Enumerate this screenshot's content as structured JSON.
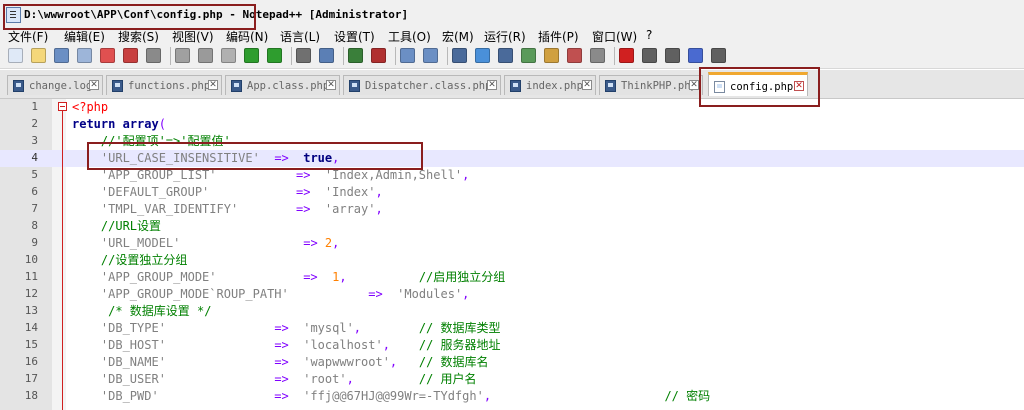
{
  "window": {
    "title": "D:\\wwwroot\\APP\\Conf\\config.php - Notepad++ [Administrator]"
  },
  "menu": {
    "items": [
      "文件(F)",
      "编辑(E)",
      "搜索(S)",
      "视图(V)",
      "编码(N)",
      "语言(L)",
      "设置(T)",
      "工具(O)",
      "宏(M)",
      "运行(R)",
      "插件(P)",
      "窗口(W)",
      "?"
    ]
  },
  "toolbar": {
    "icons": [
      "new-file-icon",
      "open-file-icon",
      "save-icon",
      "save-all-icon",
      "close-icon",
      "close-all-icon",
      "print-icon",
      "cut-icon",
      "copy-icon",
      "paste-icon",
      "undo-icon",
      "redo-icon",
      "find-icon",
      "replace-icon",
      "zoom-in-icon",
      "zoom-out-icon",
      "sync-vertical-icon",
      "sync-horizontal-icon",
      "word-wrap-icon",
      "show-all-chars-icon",
      "indent-guide-icon",
      "doc-map-icon",
      "function-list-icon",
      "folder-workspace-icon",
      "monitor-icon",
      "record-macro-icon",
      "stop-macro-icon",
      "play-macro-icon",
      "run-macro-multiple-icon",
      "save-macro-icon"
    ]
  },
  "tabs": [
    {
      "label": "change.log",
      "active": false
    },
    {
      "label": "functions.php",
      "active": false
    },
    {
      "label": "App.class.php",
      "active": false
    },
    {
      "label": "Dispatcher.class.php",
      "active": false
    },
    {
      "label": "index.php",
      "active": false
    },
    {
      "label": "ThinkPHP.php",
      "active": false
    },
    {
      "label": "config.php",
      "active": true
    }
  ],
  "editor": {
    "current_line": 4,
    "lines": [
      {
        "n": "1",
        "parts": [
          [
            "tag",
            "<?php"
          ]
        ]
      },
      {
        "n": "2",
        "parts": [
          [
            "kw",
            "return"
          ],
          [
            "pl",
            " "
          ],
          [
            "kw",
            "array"
          ],
          [
            "op",
            "("
          ]
        ]
      },
      {
        "n": "3",
        "parts": [
          [
            "cmt",
            "    //'配置项'=>'配置值'"
          ]
        ]
      },
      {
        "n": "4",
        "parts": [
          [
            "pl",
            "    "
          ],
          [
            "str",
            "'URL_CASE_INSENSITIVE'"
          ],
          [
            "pl",
            "  "
          ],
          [
            "op",
            "=>"
          ],
          [
            "pl",
            "  "
          ],
          [
            "bool",
            "true"
          ],
          [
            "op",
            ","
          ]
        ]
      },
      {
        "n": "5",
        "parts": [
          [
            "pl",
            "    "
          ],
          [
            "str",
            "'APP_GROUP_LIST'"
          ],
          [
            "pl",
            "           "
          ],
          [
            "op",
            "=>"
          ],
          [
            "pl",
            "  "
          ],
          [
            "str",
            "'Index,Admin,Shell'"
          ],
          [
            "op",
            ","
          ]
        ]
      },
      {
        "n": "6",
        "parts": [
          [
            "pl",
            "    "
          ],
          [
            "str",
            "'DEFAULT_GROUP'"
          ],
          [
            "pl",
            "            "
          ],
          [
            "op",
            "=>"
          ],
          [
            "pl",
            "  "
          ],
          [
            "str",
            "'Index'"
          ],
          [
            "op",
            ","
          ]
        ]
      },
      {
        "n": "7",
        "parts": [
          [
            "pl",
            "    "
          ],
          [
            "str",
            "'TMPL_VAR_IDENTIFY'"
          ],
          [
            "pl",
            "        "
          ],
          [
            "op",
            "=>"
          ],
          [
            "pl",
            "  "
          ],
          [
            "str",
            "'array'"
          ],
          [
            "op",
            ","
          ]
        ]
      },
      {
        "n": "8",
        "parts": [
          [
            "cmt",
            "    //URL设置"
          ]
        ]
      },
      {
        "n": "9",
        "parts": [
          [
            "pl",
            "    "
          ],
          [
            "str",
            "'URL_MODEL'"
          ],
          [
            "pl",
            "                 "
          ],
          [
            "op",
            "=>"
          ],
          [
            "pl",
            " "
          ],
          [
            "num",
            "2"
          ],
          [
            "op",
            ","
          ]
        ]
      },
      {
        "n": "10",
        "parts": [
          [
            "cmt",
            "    //设置独立分组"
          ]
        ]
      },
      {
        "n": "11",
        "parts": [
          [
            "pl",
            "    "
          ],
          [
            "str",
            "'APP_GROUP_MODE'"
          ],
          [
            "pl",
            "            "
          ],
          [
            "op",
            "=>"
          ],
          [
            "pl",
            "  "
          ],
          [
            "num",
            "1"
          ],
          [
            "op",
            ","
          ],
          [
            "pl",
            "          "
          ],
          [
            "cmt",
            "//启用独立分组"
          ]
        ]
      },
      {
        "n": "12",
        "parts": [
          [
            "pl",
            "    "
          ],
          [
            "str",
            "'APP_GROUP_MODE`ROUP_PATH'"
          ],
          [
            "pl",
            "           "
          ],
          [
            "op",
            "=>"
          ],
          [
            "pl",
            "  "
          ],
          [
            "str",
            "'Modules'"
          ],
          [
            "op",
            ","
          ]
        ]
      },
      {
        "n": "13",
        "parts": [
          [
            "cmt",
            "     /* 数据库设置 */"
          ]
        ]
      },
      {
        "n": "14",
        "parts": [
          [
            "pl",
            "    "
          ],
          [
            "str",
            "'DB_TYPE'"
          ],
          [
            "pl",
            "               "
          ],
          [
            "op",
            "=>"
          ],
          [
            "pl",
            "  "
          ],
          [
            "str",
            "'mysql'"
          ],
          [
            "op",
            ","
          ],
          [
            "pl",
            "        "
          ],
          [
            "cmt",
            "// 数据库类型"
          ]
        ]
      },
      {
        "n": "15",
        "parts": [
          [
            "pl",
            "    "
          ],
          [
            "str",
            "'DB_HOST'"
          ],
          [
            "pl",
            "               "
          ],
          [
            "op",
            "=>"
          ],
          [
            "pl",
            "  "
          ],
          [
            "str",
            "'localhost'"
          ],
          [
            "op",
            ","
          ],
          [
            "pl",
            "    "
          ],
          [
            "cmt",
            "// 服务器地址"
          ]
        ]
      },
      {
        "n": "16",
        "parts": [
          [
            "pl",
            "    "
          ],
          [
            "str",
            "'DB_NAME'"
          ],
          [
            "pl",
            "               "
          ],
          [
            "op",
            "=>"
          ],
          [
            "pl",
            "  "
          ],
          [
            "str",
            "'wapwwwroot'"
          ],
          [
            "op",
            ","
          ],
          [
            "pl",
            "   "
          ],
          [
            "cmt",
            "// 数据库名"
          ]
        ]
      },
      {
        "n": "17",
        "parts": [
          [
            "pl",
            "    "
          ],
          [
            "str",
            "'DB_USER'"
          ],
          [
            "pl",
            "               "
          ],
          [
            "op",
            "=>"
          ],
          [
            "pl",
            "  "
          ],
          [
            "str",
            "'root'"
          ],
          [
            "op",
            ","
          ],
          [
            "pl",
            "         "
          ],
          [
            "cmt",
            "// 用户名"
          ]
        ]
      },
      {
        "n": "18",
        "parts": [
          [
            "pl",
            "    "
          ],
          [
            "str",
            "'DB_PWD'"
          ],
          [
            "pl",
            "                "
          ],
          [
            "op",
            "=>"
          ],
          [
            "pl",
            "  "
          ],
          [
            "str",
            "'ffj@@67HJ@@99Wr=-TYdfgh'"
          ],
          [
            "op",
            ","
          ],
          [
            "pl",
            "                        "
          ],
          [
            "cmt",
            "// 密码"
          ]
        ]
      }
    ]
  },
  "colors": {
    "annotation_box": "#8a1e1e",
    "active_tab_accent": "#f0a830",
    "current_line_bg": "#e8e8ff"
  }
}
